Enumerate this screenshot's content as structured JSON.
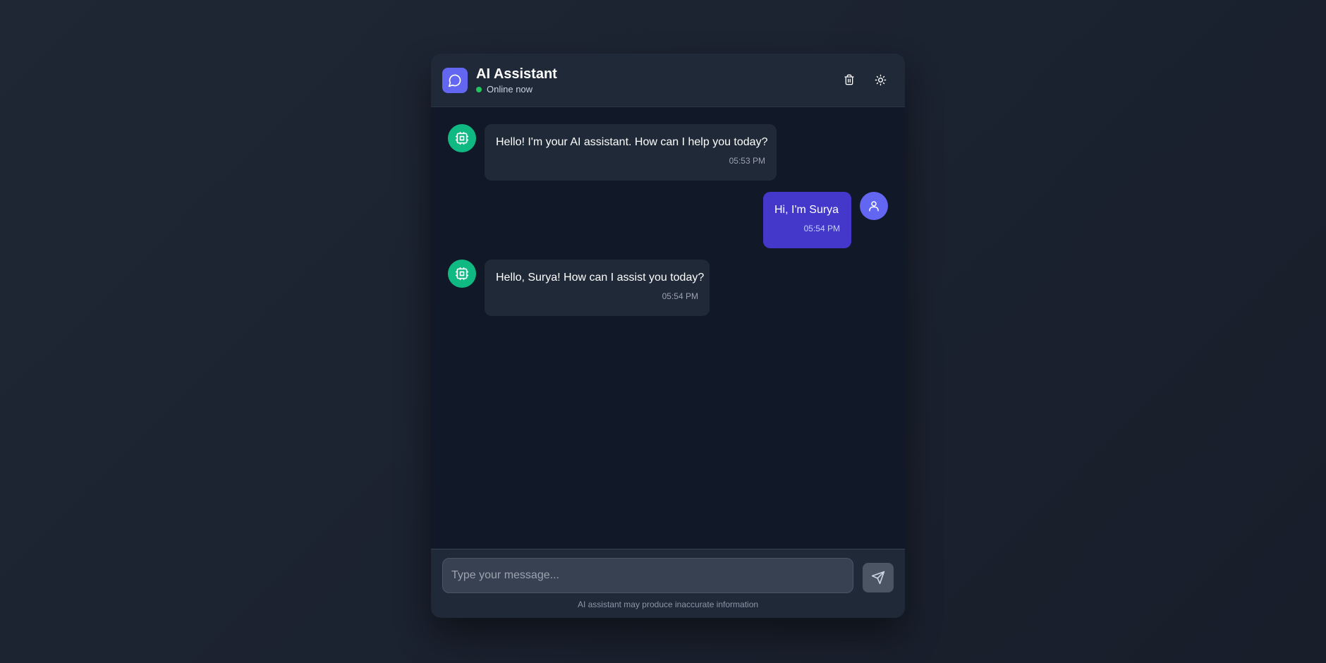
{
  "header": {
    "title": "AI Assistant",
    "status": "Online now",
    "app_icon": "chat-bubble-icon",
    "actions": [
      {
        "icon": "trash-icon"
      },
      {
        "icon": "sun-icon"
      }
    ]
  },
  "messages": [
    {
      "sender": "bot",
      "text": "Hello! I'm your AI assistant. How can I help you today?",
      "time": "05:53 PM"
    },
    {
      "sender": "user",
      "text": "Hi, I'm Surya",
      "time": "05:54 PM"
    },
    {
      "sender": "bot",
      "text": "Hello, Surya! How can I assist you today?",
      "time": "05:54 PM"
    }
  ],
  "composer": {
    "placeholder": "Type your message...",
    "value": "",
    "send_icon": "send-icon",
    "disclaimer": "AI assistant may produce inaccurate information"
  },
  "colors": {
    "accent": "#6366f1",
    "user_bubble": "#4338ca",
    "bot_avatar": "#10b981",
    "status_online": "#22c55e"
  }
}
